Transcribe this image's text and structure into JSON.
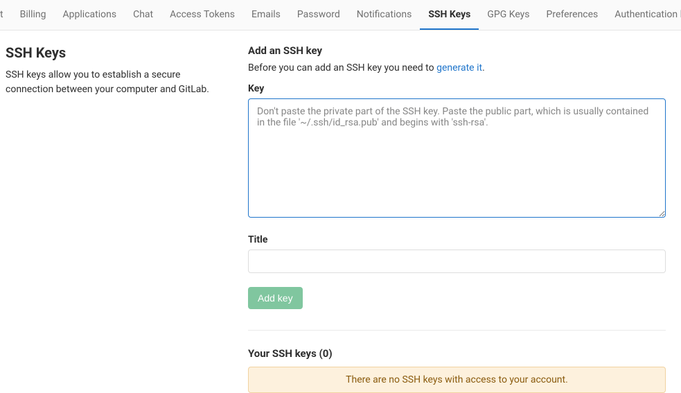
{
  "tabs": {
    "items": [
      {
        "label": "t",
        "active": false
      },
      {
        "label": "Billing",
        "active": false
      },
      {
        "label": "Applications",
        "active": false
      },
      {
        "label": "Chat",
        "active": false
      },
      {
        "label": "Access Tokens",
        "active": false
      },
      {
        "label": "Emails",
        "active": false
      },
      {
        "label": "Password",
        "active": false
      },
      {
        "label": "Notifications",
        "active": false
      },
      {
        "label": "SSH Keys",
        "active": true
      },
      {
        "label": "GPG Keys",
        "active": false
      },
      {
        "label": "Preferences",
        "active": false
      },
      {
        "label": "Authentication log",
        "active": false
      }
    ]
  },
  "left": {
    "title": "SSH Keys",
    "description": "SSH keys allow you to establish a secure connection between your computer and GitLab."
  },
  "form": {
    "heading": "Add an SSH key",
    "helper_prefix": "Before you can add an SSH key you need to ",
    "helper_link": "generate it",
    "helper_suffix": ".",
    "key_label": "Key",
    "key_placeholder": "Don't paste the private part of the SSH key. Paste the public part, which is usually contained in the file '~/.ssh/id_rsa.pub' and begins with 'ssh-rsa'.",
    "title_label": "Title",
    "title_value": "",
    "submit_label": "Add key"
  },
  "your_keys": {
    "heading": "Your SSH keys (0)",
    "empty_message": "There are no SSH keys with access to your account."
  }
}
